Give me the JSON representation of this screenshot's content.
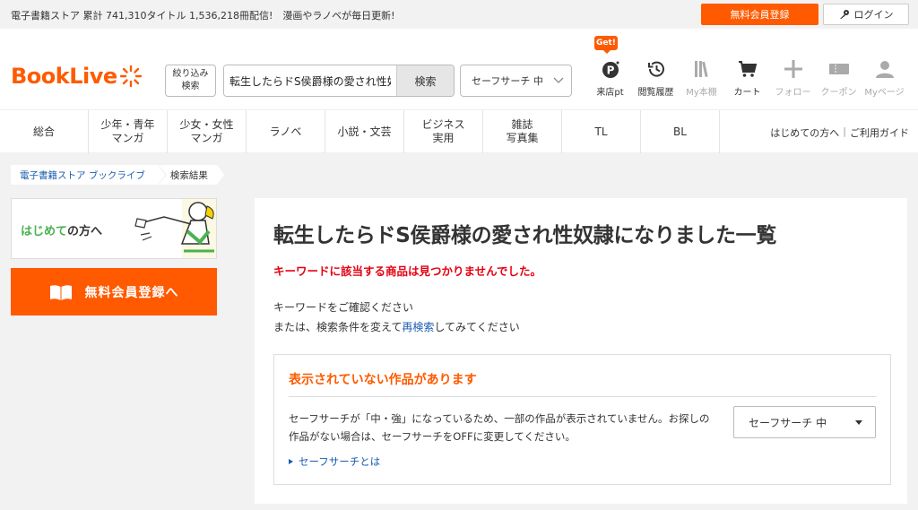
{
  "topbar": {
    "promo": "電子書籍ストア 累計 741,310タイトル 1,536,218冊配信!　漫画やラノベが毎日更新!",
    "register_label": "無料会員登録",
    "login_label": "ログイン"
  },
  "header": {
    "logo_text": "BookLive",
    "filter_line1": "絞り込み",
    "filter_line2": "検索",
    "search_value": "転生したらドS侯爵様の愛され性奴隷になりました",
    "search_button": "検索",
    "safe_search": "セーフサーチ 中",
    "get_badge": "Get!",
    "icons": [
      {
        "name": "points-icon",
        "label": "来店pt",
        "disabled": false
      },
      {
        "name": "history-icon",
        "label": "閲覧履歴",
        "disabled": false
      },
      {
        "name": "bookshelf-icon",
        "label": "My本棚",
        "disabled": true
      },
      {
        "name": "cart-icon",
        "label": "カート",
        "disabled": false
      },
      {
        "name": "plus-icon",
        "label": "フォロー",
        "disabled": true
      },
      {
        "name": "coupon-icon",
        "label": "クーポン",
        "disabled": true
      },
      {
        "name": "user-icon",
        "label": "Myページ",
        "disabled": true
      }
    ]
  },
  "categories": [
    {
      "line1": "総合",
      "line2": ""
    },
    {
      "line1": "少年・青年",
      "line2": "マンガ"
    },
    {
      "line1": "少女・女性",
      "line2": "マンガ"
    },
    {
      "line1": "ラノベ",
      "line2": ""
    },
    {
      "line1": "小説・文芸",
      "line2": ""
    },
    {
      "line1": "ビジネス",
      "line2": "実用"
    },
    {
      "line1": "雑誌",
      "line2": "写真集"
    },
    {
      "line1": "TL",
      "line2": ""
    },
    {
      "line1": "BL",
      "line2": ""
    }
  ],
  "nav_links": {
    "first_time": "はじめての方へ",
    "guide": "ご利用ガイド"
  },
  "breadcrumb": {
    "home": "電子書籍ストア ブックライブ",
    "current": "検索結果"
  },
  "sidebar": {
    "banner_first_green": "はじめて",
    "banner_first_dark": "の方へ",
    "banner_register": "無料会員登録へ"
  },
  "main": {
    "title": "転生したらドS侯爵様の愛され性奴隷になりました一覧",
    "not_found": "キーワードに該当する商品は見つかりませんでした。",
    "msg1": "キーワードをご確認ください",
    "msg2_pre": "または、検索条件を変えて",
    "msg2_link": "再検索",
    "msg2_post": "してみてください",
    "hidden_box": {
      "title": "表示されていない作品があります",
      "text": "セーフサーチが「中・強」になっているため、一部の作品が表示されていません。お探しの作品がない場合は、セーフサーチをOFFに変更してください。",
      "link": "セーフサーチとは",
      "select_value": "セーフサーチ 中"
    }
  },
  "colors": {
    "brand_orange": "#ff5a00",
    "error_red": "#e60012",
    "link_blue": "#1a5db0",
    "green": "#4ab24f"
  }
}
